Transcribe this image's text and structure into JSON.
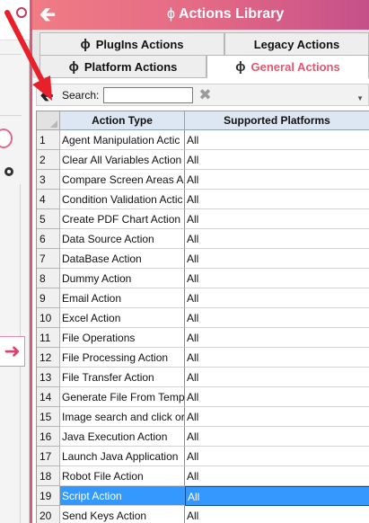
{
  "header": {
    "title": "Actions Library",
    "back_icon": "arrow-left-icon",
    "title_icon": "lightning-bolt-icon"
  },
  "tabs": {
    "row1": [
      {
        "label": "PlugIns Actions",
        "icon": "bolt-plug-icon",
        "active": false
      },
      {
        "label": "Legacy Actions",
        "icon": "",
        "active": false
      }
    ],
    "row2": [
      {
        "label": "Platform Actions",
        "icon": "bolt-gear-icon",
        "active": false
      },
      {
        "label": "General Actions",
        "icon": "bolt-globe-icon",
        "active": true
      }
    ]
  },
  "search": {
    "label": "Search:",
    "value": "",
    "placeholder": ""
  },
  "grid": {
    "columns": [
      "Action Type",
      "Supported Platforms"
    ],
    "rows": [
      {
        "n": "1",
        "type": "Agent Manipulation Actic",
        "platforms": "All"
      },
      {
        "n": "2",
        "type": "Clear All Variables Action",
        "platforms": "All"
      },
      {
        "n": "3",
        "type": "Compare Screen Areas Ac",
        "platforms": "All"
      },
      {
        "n": "4",
        "type": "Condition Validation Actic",
        "platforms": "All"
      },
      {
        "n": "5",
        "type": "Create PDF Chart Action",
        "platforms": "All"
      },
      {
        "n": "6",
        "type": "Data Source Action",
        "platforms": "All"
      },
      {
        "n": "7",
        "type": "DataBase Action",
        "platforms": "All"
      },
      {
        "n": "8",
        "type": "Dummy Action",
        "platforms": "All"
      },
      {
        "n": "9",
        "type": "Email Action",
        "platforms": "All"
      },
      {
        "n": "10",
        "type": "Excel Action",
        "platforms": "All"
      },
      {
        "n": "11",
        "type": "File Operations",
        "platforms": "All"
      },
      {
        "n": "12",
        "type": "File Processing Action",
        "platforms": "All"
      },
      {
        "n": "13",
        "type": "File Transfer Action",
        "platforms": "All"
      },
      {
        "n": "14",
        "type": "Generate File From Templ",
        "platforms": "All"
      },
      {
        "n": "15",
        "type": "Image search and click or",
        "platforms": "All"
      },
      {
        "n": "16",
        "type": "Java Execution Action",
        "platforms": "All"
      },
      {
        "n": "17",
        "type": "Launch Java Application",
        "platforms": "All"
      },
      {
        "n": "18",
        "type": "Robot File Action",
        "platforms": "All"
      },
      {
        "n": "19",
        "type": "Script Action",
        "platforms": "All",
        "selected": true
      },
      {
        "n": "20",
        "type": "Send Keys Action",
        "platforms": "All"
      }
    ]
  },
  "colors": {
    "header_gradient_start": "#f07c84",
    "header_gradient_end": "#c55089",
    "active_tab_text": "#e2566f",
    "selection": "#3399ff",
    "pointer_arrow": "#e8202a"
  }
}
